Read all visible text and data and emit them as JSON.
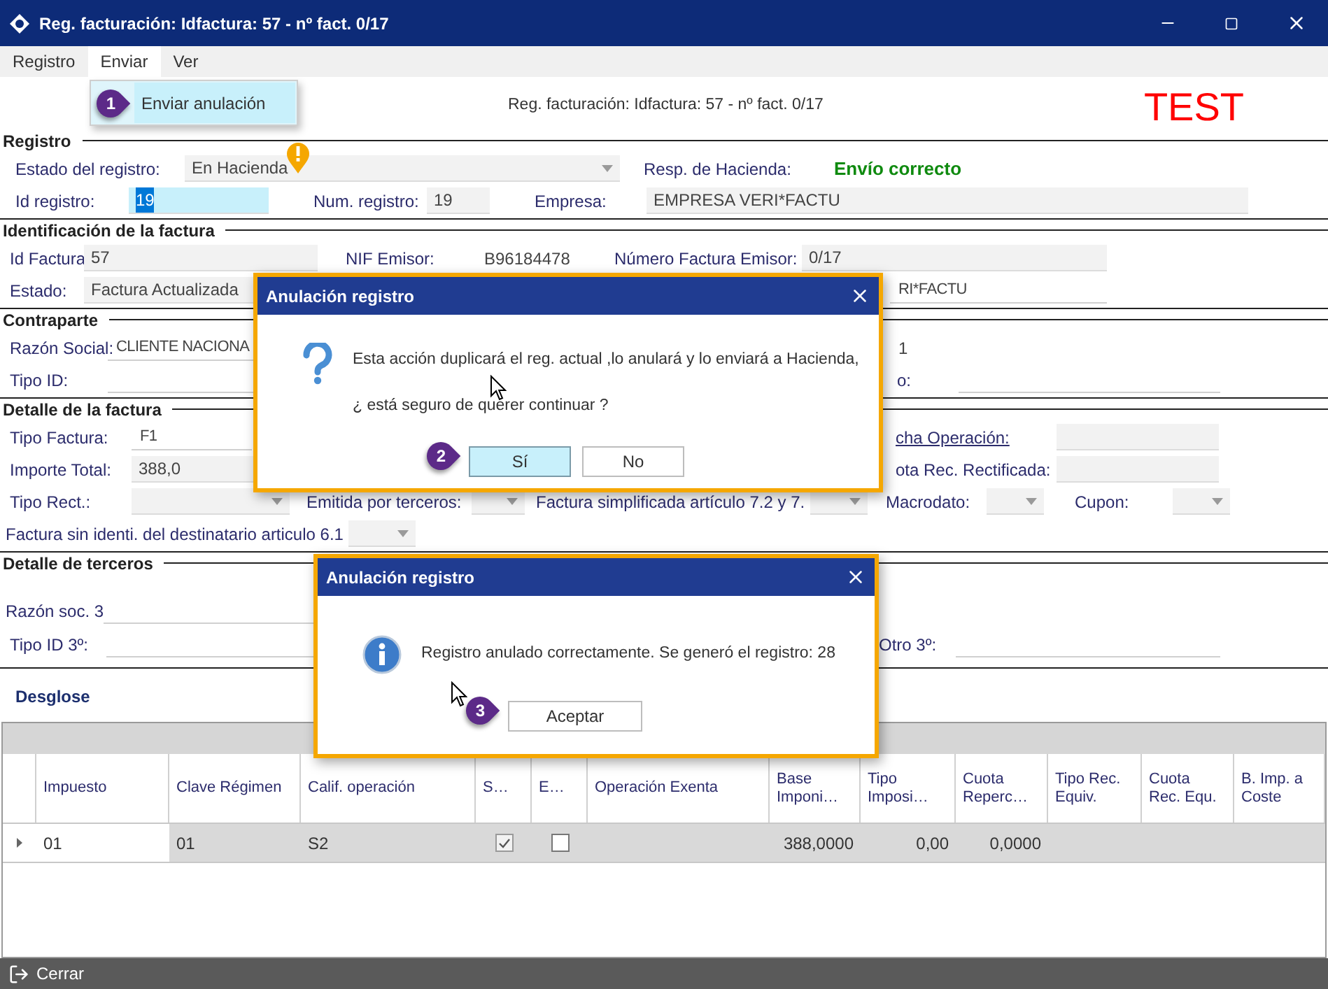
{
  "window": {
    "title": "Reg. facturación: Idfactura: 57 - nº fact. 0/17"
  },
  "menu": [
    {
      "label": "Registro",
      "selected": false
    },
    {
      "label": "Enviar",
      "selected": true
    },
    {
      "label": "Ver",
      "selected": false
    }
  ],
  "dropdown": {
    "items": [
      {
        "label": "Enviar anulación",
        "selected": true,
        "step": "1"
      }
    ]
  },
  "header": {
    "caption": "Reg. facturación: Idfactura: 57 - nº fact. 0/17",
    "badge": "TEST"
  },
  "sections": [
    {
      "title": "Registro",
      "rows": [
        {
          "fields": [
            {
              "label": "Estado del registro:",
              "control": {
                "kind": "select",
                "value": "En Hacienda",
                "warning": true
              }
            },
            {
              "label": "Resp. de Hacienda:",
              "control": {
                "kind": "status",
                "text": "Envío correcto"
              }
            }
          ]
        },
        {
          "fields": [
            {
              "label": "Id registro:",
              "control": {
                "kind": "field",
                "value": "19",
                "selected": true
              }
            },
            {
              "label": "Num. registro:",
              "control": {
                "kind": "field",
                "value": "19",
                "selected": false
              }
            },
            {
              "label": "Empresa:",
              "control": {
                "kind": "field",
                "value": "EMPRESA VERI*FACTU",
                "selected": false
              }
            }
          ]
        }
      ]
    },
    {
      "title": "Identificación de la factura",
      "rows": [
        {
          "fields": [
            {
              "label": "Id Factura",
              "control": {
                "kind": "field",
                "value": "57",
                "selected": false
              }
            },
            {
              "label": "NIF Emisor:",
              "control": {
                "kind": "value",
                "text": "B96184478"
              }
            },
            {
              "label": "Número Factura Emisor:",
              "control": {
                "kind": "field",
                "value": "0/17",
                "selected": false
              }
            }
          ]
        },
        {
          "fields": [
            {
              "label": "Estado:",
              "control": {
                "kind": "field",
                "value": "Factura Actualizada",
                "selected": false
              }
            },
            {
              "control": {
                "kind": "line",
                "value": "RI*FACTU"
              }
            }
          ]
        }
      ]
    },
    {
      "title": "Contraparte",
      "rows": [
        {
          "fields": [
            {
              "label": "Razón Social:",
              "control": {
                "kind": "line",
                "value": "CLIENTE NACIONA"
              }
            },
            {
              "control": {
                "kind": "value",
                "text": "1"
              }
            }
          ]
        },
        {
          "fields": [
            {
              "label": "Tipo ID:",
              "control": {
                "kind": "line"
              }
            },
            {
              "label": "o:",
              "control": {
                "kind": "line"
              }
            }
          ]
        }
      ]
    },
    {
      "title": "Detalle de la factura",
      "rows": [
        {
          "fields": [
            {
              "label": "Tipo Factura:",
              "control": {
                "kind": "line",
                "value": "F1"
              }
            },
            {
              "link": "cha Operación:",
              "control": {
                "kind": "field",
                "selected": false
              }
            }
          ]
        },
        {
          "fields": [
            {
              "label": "Importe Total:",
              "control": {
                "kind": "field",
                "value": "388,0",
                "selected": false
              }
            },
            {
              "label": "ota Rec. Rectificada:",
              "control": {
                "kind": "field",
                "selected": false
              }
            }
          ]
        },
        {
          "fields": [
            {
              "label": "Tipo Rect.:",
              "control": {
                "kind": "select"
              }
            },
            {
              "label": "Emitida por terceros:",
              "control": {
                "kind": "select"
              }
            },
            {
              "label": "Factura simplificada artículo 7.2 y 7.",
              "control": {
                "kind": "select"
              }
            },
            {
              "label": "Macrodato:",
              "control": {
                "kind": "select"
              }
            },
            {
              "label": "Cupon:",
              "control": {
                "kind": "select"
              }
            }
          ]
        },
        {
          "fields": [
            {
              "label": "Factura sin identi. del destinatario articulo 6.1",
              "control": {
                "kind": "select"
              }
            }
          ]
        }
      ]
    },
    {
      "title": "Detalle de terceros",
      "rows": [
        {
          "fields": [
            {
              "label": "Razón soc. 3",
              "control": {
                "kind": "line"
              }
            }
          ]
        },
        {
          "fields": [
            {
              "label": "Tipo ID 3º:",
              "control": {
                "kind": "line"
              }
            },
            {
              "label": "Otro 3º:",
              "control": {
                "kind": "line"
              }
            }
          ]
        }
      ]
    }
  ],
  "desglose": {
    "title": "Desglose",
    "columns": [
      "Impuesto",
      "Clave Régimen",
      "Calif. operación",
      "S…",
      "E…",
      "Operación Exenta",
      "Base Imponi…",
      "Tipo Imposi…",
      "Cuota Reperc…",
      "Tipo Rec. Equiv.",
      "Cuota Rec. Equ.",
      "B. Imp. a Coste"
    ],
    "rows": [
      {
        "cells": [
          {
            "kind": "text",
            "value": "01"
          },
          {
            "kind": "text",
            "value": "01"
          },
          {
            "kind": "text",
            "value": "S2"
          },
          {
            "kind": "check",
            "checked": true
          },
          {
            "kind": "check",
            "checked": false
          },
          {
            "kind": "empty"
          },
          {
            "kind": "number",
            "value": "388,0000"
          },
          {
            "kind": "number",
            "value": "0,00"
          },
          {
            "kind": "number",
            "value": "0,0000"
          },
          {
            "kind": "empty"
          },
          {
            "kind": "empty"
          },
          {
            "kind": "empty"
          }
        ]
      }
    ]
  },
  "footer": {
    "button": "Cerrar"
  },
  "dialogs": [
    {
      "title": "Anulación registro",
      "lines": [
        "Esta acción duplicará el reg. actual ,lo anulará y lo enviará a Hacienda,",
        "¿ está seguro de querer continuar ?"
      ],
      "buttons": [
        {
          "label": "Sí",
          "selected": true,
          "step": "2"
        },
        {
          "label": "No",
          "selected": false
        }
      ]
    },
    {
      "title": "Anulación registro",
      "lines": [
        "Registro anulado correctamente. Se generó el registro: 28"
      ],
      "buttons": [
        {
          "label": "Aceptar",
          "selected": false,
          "step": "3"
        }
      ]
    }
  ]
}
